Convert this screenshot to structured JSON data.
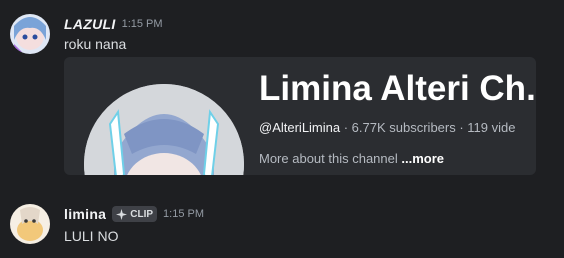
{
  "messages": [
    {
      "author": "LAZULI",
      "time": "1:15 PM",
      "text": "roku nana"
    },
    {
      "author": "limina",
      "badge": "CLIP",
      "time": "1:15 PM",
      "text": "LULI NO"
    }
  ],
  "embed": {
    "title": "Limina Alteri Ch.",
    "handle": "@AlteriLimina",
    "meta_rest": " · 6.77K subscribers · 119 vide",
    "more_text": "More about this channel ",
    "more_link": "...more"
  },
  "colors": {
    "background": "#1e1f22",
    "embed_bg": "#2b2d31",
    "text": "#dbdee1",
    "muted": "#949ba4"
  },
  "icons": {
    "badge_icon": "sparkle-icon"
  }
}
